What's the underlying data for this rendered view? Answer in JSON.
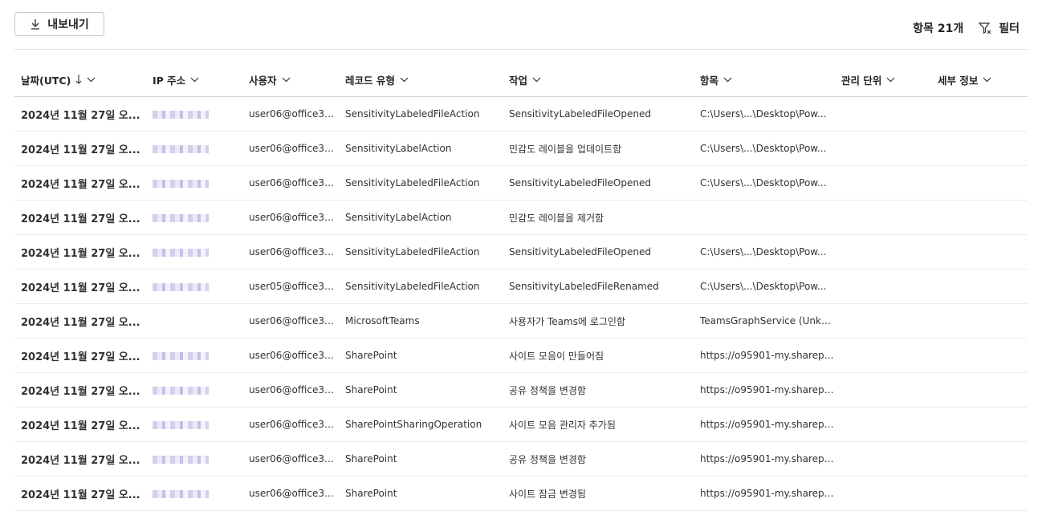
{
  "toolbar": {
    "export_label": "내보내기",
    "count_label": "항목 21개",
    "filter_label": "필터"
  },
  "columns": [
    "날짜(UTC)",
    "IP 주소",
    "사용자",
    "레코드 유형",
    "작업",
    "항목",
    "관리 단위",
    "세부 정보"
  ],
  "rows": [
    {
      "date": "2024년 11월 27일 오...",
      "user": "user06@office36...",
      "record": "SensitivityLabeledFileAction",
      "op": "SensitivityLabeledFileOpened",
      "item": "C:\\Users\\...\\Desktop\\Pow..."
    },
    {
      "date": "2024년 11월 27일 오...",
      "user": "user06@office36...",
      "record": "SensitivityLabelAction",
      "op": "민감도 레이블을 업데이트함",
      "item": "C:\\Users\\...\\Desktop\\Pow..."
    },
    {
      "date": "2024년 11월 27일 오...",
      "user": "user06@office36...",
      "record": "SensitivityLabeledFileAction",
      "op": "SensitivityLabeledFileOpened",
      "item": "C:\\Users\\...\\Desktop\\Pow..."
    },
    {
      "date": "2024년 11월 27일 오...",
      "user": "user06@office36...",
      "record": "SensitivityLabelAction",
      "op": "민감도 레이블을 제거함",
      "item": ""
    },
    {
      "date": "2024년 11월 27일 오...",
      "user": "user06@office36...",
      "record": "SensitivityLabeledFileAction",
      "op": "SensitivityLabeledFileOpened",
      "item": "C:\\Users\\...\\Desktop\\Pow..."
    },
    {
      "date": "2024년 11월 27일 오...",
      "user": "user05@office36...",
      "record": "SensitivityLabeledFileAction",
      "op": "SensitivityLabeledFileRenamed",
      "item": "C:\\Users\\...\\Desktop\\Pow..."
    },
    {
      "date": "2024년 11월 27일 오...",
      "user": "user06@office36...",
      "record": "MicrosoftTeams",
      "op": "사용자가 Teams에 로그인함",
      "item": "TeamsGraphService (Unkno..."
    },
    {
      "date": "2024년 11월 27일 오...",
      "user": "user06@office36...",
      "record": "SharePoint",
      "op": "사이트 모음이 만들어짐",
      "item": "https://o95901-my.sharepoi..."
    },
    {
      "date": "2024년 11월 27일 오...",
      "user": "user06@office36...",
      "record": "SharePoint",
      "op": "공유 정책을 변경함",
      "item": "https://o95901-my.sharepoi..."
    },
    {
      "date": "2024년 11월 27일 오...",
      "user": "user06@office36...",
      "record": "SharePointSharingOperation",
      "op": "사이트 모음 관리자 추가됨",
      "item": "https://o95901-my.sharepoi..."
    },
    {
      "date": "2024년 11월 27일 오...",
      "user": "user06@office36...",
      "record": "SharePoint",
      "op": "공유 정책을 변경함",
      "item": "https://o95901-my.sharepoi..."
    },
    {
      "date": "2024년 11월 27일 오...",
      "user": "user06@office36...",
      "record": "SharePoint",
      "op": "사이트 잠금 변경됨",
      "item": "https://o95901-my.sharepoi..."
    }
  ]
}
